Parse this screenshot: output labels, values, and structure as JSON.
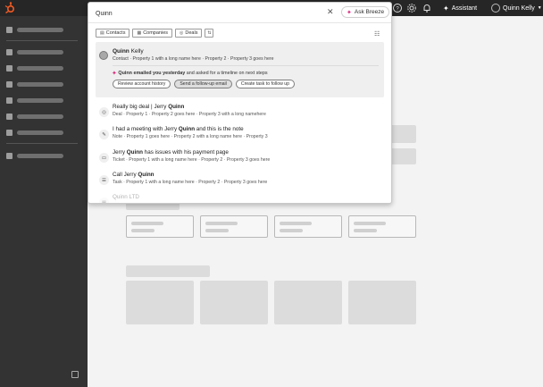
{
  "topbar": {
    "assistant_label": "Assistant",
    "user_name": "Quinn Kelly"
  },
  "search": {
    "value": "Quinn"
  },
  "ask_breeze_label": "Ask Breeze",
  "filters": [
    {
      "label": "Contacts",
      "icon": "contact-icon"
    },
    {
      "label": "Companies",
      "icon": "company-icon"
    },
    {
      "label": "Deals",
      "icon": "deal-icon"
    }
  ],
  "top_result": {
    "name_bold": "Quinn",
    "name_rest": " Kelly",
    "meta": "Contact · Property 1 with a long name here · Property 2 · Property 3 goes here",
    "ai_bold": "Quinn emailed you yesterday",
    "ai_rest": " and asked for a timeline on next steps",
    "actions": [
      "Review account history",
      "Send a follow-up email",
      "Create task to follow up"
    ]
  },
  "results": [
    {
      "icon": "deal-icon",
      "glyph": "◎",
      "pre": "Really big deal | Jerry ",
      "bold": "Quinn",
      "post": "",
      "meta": "Deal · Property 1 · Property 2 goes here · Property 3 with a long namehere"
    },
    {
      "icon": "note-icon",
      "glyph": "✎",
      "pre": "I had a meeting with Jerry ",
      "bold": "Quinn",
      "post": " and this is the note",
      "meta": "Note · Property 1 goes here · Property 2 with a long name here · Property 3"
    },
    {
      "icon": "ticket-icon",
      "glyph": "▭",
      "pre": "Jerry ",
      "bold": "Quinn",
      "post": " has issues with his payment page",
      "meta": "Ticket · Property 1 with a long name here · Property 2 · Property 3 goes here"
    },
    {
      "icon": "task-icon",
      "glyph": "☰",
      "pre": "Call Jerry ",
      "bold": "Quinn",
      "post": "",
      "meta": "Task · Property 1 with a long name here · Property 2 · Property 3 goes here"
    },
    {
      "icon": "company-icon",
      "glyph": "▦",
      "pre": "Quinn LTD",
      "bold": "",
      "post": "",
      "meta": ""
    }
  ],
  "colors": {
    "topbar": "#262626",
    "sidebar": "#333333",
    "accent_pink": "#d6287c",
    "logo_orange": "#f05a24"
  }
}
